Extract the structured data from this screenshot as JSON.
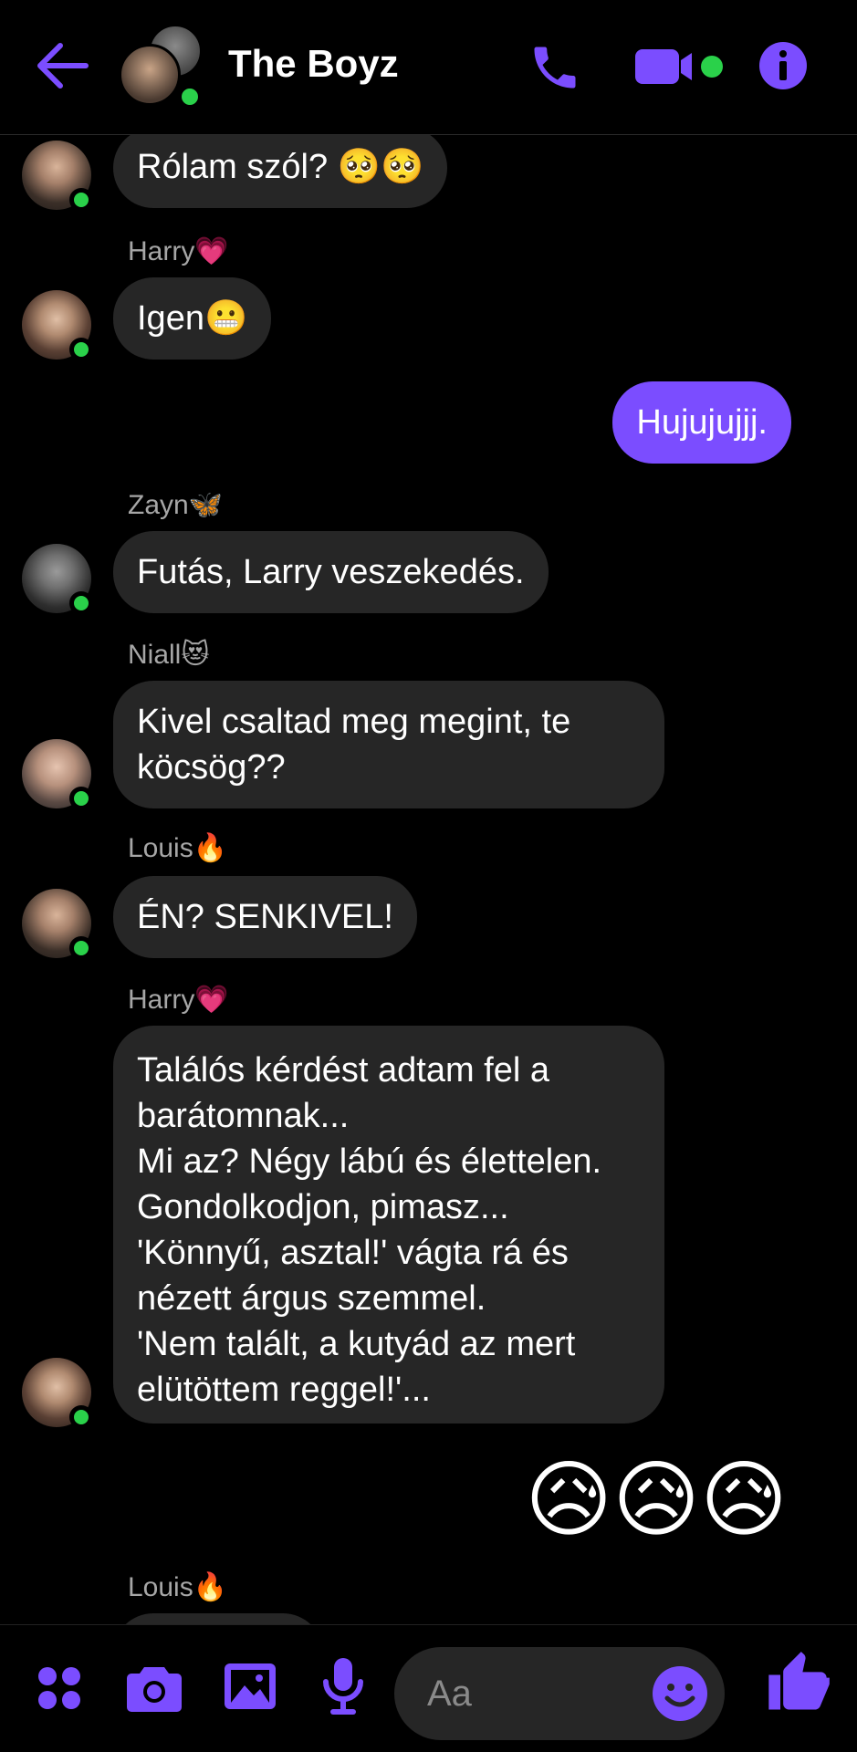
{
  "header": {
    "title": "The Boyz",
    "back_icon": "arrow-left-icon",
    "call_icon": "phone-icon",
    "video_icon": "video-camera-icon",
    "info_icon": "info-icon",
    "accent": "#7b4dff"
  },
  "messages": [
    {
      "type": "incoming",
      "avatar": "louis",
      "text": "Rólam szól? 🥺🥺"
    },
    {
      "type": "incoming",
      "sender": "Harry💗",
      "avatar": "harry",
      "text": "Igen😬"
    },
    {
      "type": "outgoing",
      "text": "Hujujujjj."
    },
    {
      "type": "incoming",
      "sender": "Zayn🦋",
      "avatar": "zayn",
      "text": "Futás, Larry veszekedés."
    },
    {
      "type": "incoming",
      "sender": "Niall😻",
      "avatar": "niall",
      "text": "Kivel csaltad meg megint, te\nköcsög??"
    },
    {
      "type": "incoming",
      "sender": "Louis🔥",
      "avatar": "louis",
      "text": "ÉN? SENKIVEL!"
    },
    {
      "type": "incoming",
      "sender": "Harry💗",
      "avatar": "harry",
      "text": "Találós kérdést adtam fel a\nbarátomnak...\nMi az? Négy lábú és élettelen.\nGondolkodjon, pimasz...\n'Könnyű, asztal!' vágta rá és\nnézett árgus szemmel.\n'Nem talált, a kutyád az mert\nelütöttem reggel!'..."
    },
    {
      "type": "outgoing-emoji",
      "text": "😥😥😥"
    },
    {
      "type": "incoming",
      "sender": "Louis🔥",
      "avatar": "louis",
      "text": ""
    }
  ],
  "composer": {
    "placeholder": "Aa",
    "apps_icon": "four-dots-icon",
    "camera_icon": "camera-icon",
    "gallery_icon": "image-icon",
    "mic_icon": "microphone-icon",
    "emoji_icon": "smiley-icon",
    "like_icon": "thumbs-up-icon"
  },
  "colors": {
    "background": "#000000",
    "bubble_incoming": "#262626",
    "bubble_outgoing": "#7b4dff",
    "online": "#2ad14a",
    "sender_name": "#a6a6a6"
  }
}
